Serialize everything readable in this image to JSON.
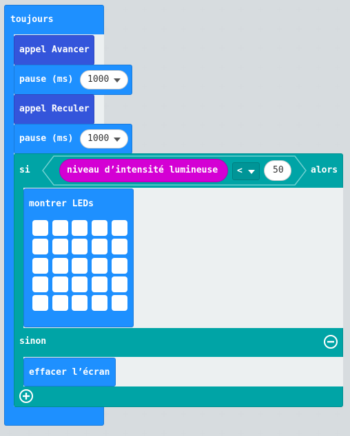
{
  "forever": {
    "label": "toujours"
  },
  "call1": {
    "label": "appel Avancer"
  },
  "pause1": {
    "label": "pause (ms)",
    "value": "1000"
  },
  "call2": {
    "label": "appel Reculer"
  },
  "pause2": {
    "label": "pause (ms)",
    "value": "1000"
  },
  "if_block": {
    "si_label": "si",
    "alors_label": "alors",
    "sensor_label": "niveau d’intensité lumineuse",
    "operator": "<",
    "compare_value": "50",
    "else_label": "sinon"
  },
  "show_leds": {
    "label": "montrer LEDs",
    "rows": 5,
    "cols": 5
  },
  "clear_screen": {
    "label": "effacer l’écran"
  },
  "colors": {
    "events": "#1e90ff",
    "functions": "#3455db",
    "logic": "#00a4a6",
    "input": "#d400d4",
    "workspace": "#ecf0f1"
  },
  "icons": [
    "dropdown-arrow-icon",
    "minus-circle-icon",
    "plus-circle-icon"
  ]
}
